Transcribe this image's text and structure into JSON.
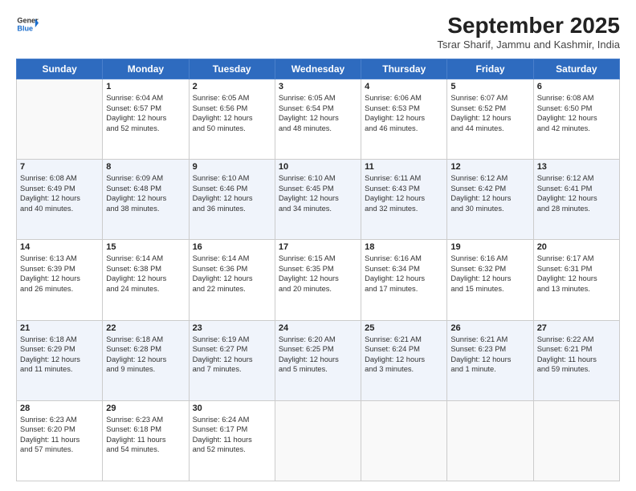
{
  "header": {
    "logo_line1": "General",
    "logo_line2": "Blue",
    "month_title": "September 2025",
    "location": "Tsrar Sharif, Jammu and Kashmir, India"
  },
  "days_of_week": [
    "Sunday",
    "Monday",
    "Tuesday",
    "Wednesday",
    "Thursday",
    "Friday",
    "Saturday"
  ],
  "weeks": [
    [
      {
        "day": "",
        "info": []
      },
      {
        "day": "1",
        "info": [
          "Sunrise: 6:04 AM",
          "Sunset: 6:57 PM",
          "Daylight: 12 hours",
          "and 52 minutes."
        ]
      },
      {
        "day": "2",
        "info": [
          "Sunrise: 6:05 AM",
          "Sunset: 6:56 PM",
          "Daylight: 12 hours",
          "and 50 minutes."
        ]
      },
      {
        "day": "3",
        "info": [
          "Sunrise: 6:05 AM",
          "Sunset: 6:54 PM",
          "Daylight: 12 hours",
          "and 48 minutes."
        ]
      },
      {
        "day": "4",
        "info": [
          "Sunrise: 6:06 AM",
          "Sunset: 6:53 PM",
          "Daylight: 12 hours",
          "and 46 minutes."
        ]
      },
      {
        "day": "5",
        "info": [
          "Sunrise: 6:07 AM",
          "Sunset: 6:52 PM",
          "Daylight: 12 hours",
          "and 44 minutes."
        ]
      },
      {
        "day": "6",
        "info": [
          "Sunrise: 6:08 AM",
          "Sunset: 6:50 PM",
          "Daylight: 12 hours",
          "and 42 minutes."
        ]
      }
    ],
    [
      {
        "day": "7",
        "info": [
          "Sunrise: 6:08 AM",
          "Sunset: 6:49 PM",
          "Daylight: 12 hours",
          "and 40 minutes."
        ]
      },
      {
        "day": "8",
        "info": [
          "Sunrise: 6:09 AM",
          "Sunset: 6:48 PM",
          "Daylight: 12 hours",
          "and 38 minutes."
        ]
      },
      {
        "day": "9",
        "info": [
          "Sunrise: 6:10 AM",
          "Sunset: 6:46 PM",
          "Daylight: 12 hours",
          "and 36 minutes."
        ]
      },
      {
        "day": "10",
        "info": [
          "Sunrise: 6:10 AM",
          "Sunset: 6:45 PM",
          "Daylight: 12 hours",
          "and 34 minutes."
        ]
      },
      {
        "day": "11",
        "info": [
          "Sunrise: 6:11 AM",
          "Sunset: 6:43 PM",
          "Daylight: 12 hours",
          "and 32 minutes."
        ]
      },
      {
        "day": "12",
        "info": [
          "Sunrise: 6:12 AM",
          "Sunset: 6:42 PM",
          "Daylight: 12 hours",
          "and 30 minutes."
        ]
      },
      {
        "day": "13",
        "info": [
          "Sunrise: 6:12 AM",
          "Sunset: 6:41 PM",
          "Daylight: 12 hours",
          "and 28 minutes."
        ]
      }
    ],
    [
      {
        "day": "14",
        "info": [
          "Sunrise: 6:13 AM",
          "Sunset: 6:39 PM",
          "Daylight: 12 hours",
          "and 26 minutes."
        ]
      },
      {
        "day": "15",
        "info": [
          "Sunrise: 6:14 AM",
          "Sunset: 6:38 PM",
          "Daylight: 12 hours",
          "and 24 minutes."
        ]
      },
      {
        "day": "16",
        "info": [
          "Sunrise: 6:14 AM",
          "Sunset: 6:36 PM",
          "Daylight: 12 hours",
          "and 22 minutes."
        ]
      },
      {
        "day": "17",
        "info": [
          "Sunrise: 6:15 AM",
          "Sunset: 6:35 PM",
          "Daylight: 12 hours",
          "and 20 minutes."
        ]
      },
      {
        "day": "18",
        "info": [
          "Sunrise: 6:16 AM",
          "Sunset: 6:34 PM",
          "Daylight: 12 hours",
          "and 17 minutes."
        ]
      },
      {
        "day": "19",
        "info": [
          "Sunrise: 6:16 AM",
          "Sunset: 6:32 PM",
          "Daylight: 12 hours",
          "and 15 minutes."
        ]
      },
      {
        "day": "20",
        "info": [
          "Sunrise: 6:17 AM",
          "Sunset: 6:31 PM",
          "Daylight: 12 hours",
          "and 13 minutes."
        ]
      }
    ],
    [
      {
        "day": "21",
        "info": [
          "Sunrise: 6:18 AM",
          "Sunset: 6:29 PM",
          "Daylight: 12 hours",
          "and 11 minutes."
        ]
      },
      {
        "day": "22",
        "info": [
          "Sunrise: 6:18 AM",
          "Sunset: 6:28 PM",
          "Daylight: 12 hours",
          "and 9 minutes."
        ]
      },
      {
        "day": "23",
        "info": [
          "Sunrise: 6:19 AM",
          "Sunset: 6:27 PM",
          "Daylight: 12 hours",
          "and 7 minutes."
        ]
      },
      {
        "day": "24",
        "info": [
          "Sunrise: 6:20 AM",
          "Sunset: 6:25 PM",
          "Daylight: 12 hours",
          "and 5 minutes."
        ]
      },
      {
        "day": "25",
        "info": [
          "Sunrise: 6:21 AM",
          "Sunset: 6:24 PM",
          "Daylight: 12 hours",
          "and 3 minutes."
        ]
      },
      {
        "day": "26",
        "info": [
          "Sunrise: 6:21 AM",
          "Sunset: 6:23 PM",
          "Daylight: 12 hours",
          "and 1 minute."
        ]
      },
      {
        "day": "27",
        "info": [
          "Sunrise: 6:22 AM",
          "Sunset: 6:21 PM",
          "Daylight: 11 hours",
          "and 59 minutes."
        ]
      }
    ],
    [
      {
        "day": "28",
        "info": [
          "Sunrise: 6:23 AM",
          "Sunset: 6:20 PM",
          "Daylight: 11 hours",
          "and 57 minutes."
        ]
      },
      {
        "day": "29",
        "info": [
          "Sunrise: 6:23 AM",
          "Sunset: 6:18 PM",
          "Daylight: 11 hours",
          "and 54 minutes."
        ]
      },
      {
        "day": "30",
        "info": [
          "Sunrise: 6:24 AM",
          "Sunset: 6:17 PM",
          "Daylight: 11 hours",
          "and 52 minutes."
        ]
      },
      {
        "day": "",
        "info": []
      },
      {
        "day": "",
        "info": []
      },
      {
        "day": "",
        "info": []
      },
      {
        "day": "",
        "info": []
      }
    ]
  ]
}
